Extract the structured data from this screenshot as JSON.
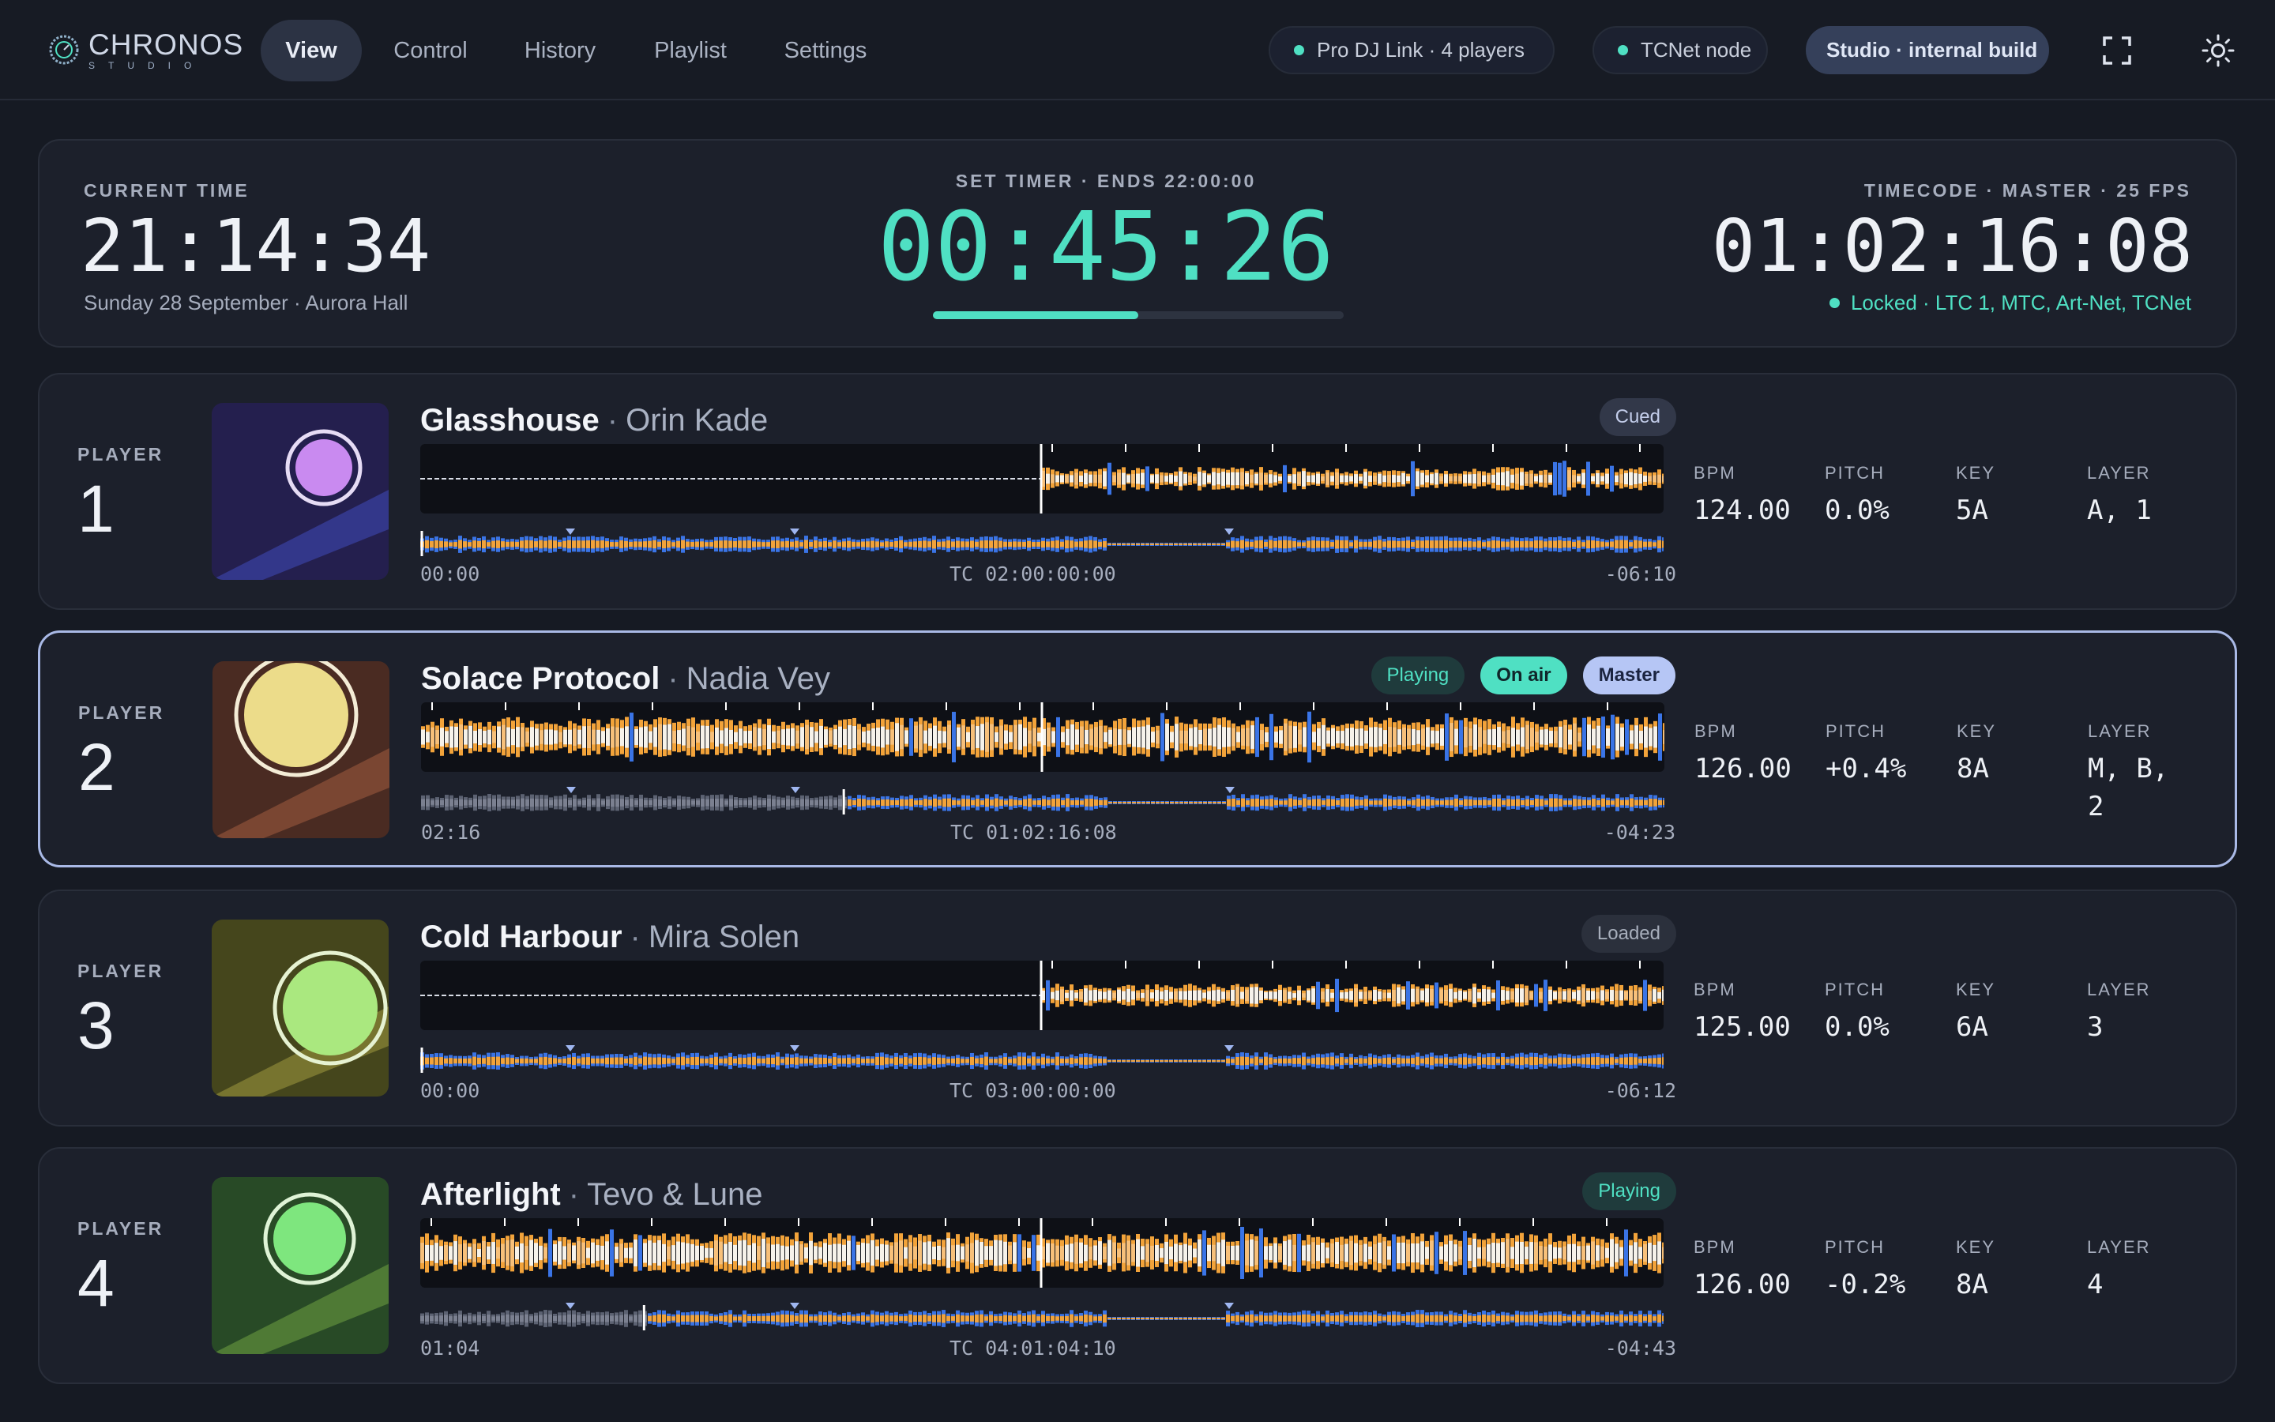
{
  "app": {
    "name": "CHRONOS",
    "sub": "STUDIO"
  },
  "nav": {
    "tabs": [
      {
        "label": "View",
        "active": true
      },
      {
        "label": "Control"
      },
      {
        "label": "History"
      },
      {
        "label": "Playlist"
      },
      {
        "label": "Settings"
      }
    ],
    "status_link": "Pro DJ Link · 4 players",
    "status_tcnet": "TCNet node",
    "build": "Studio · internal build",
    "icons": [
      "fullscreen-icon",
      "brightness-icon"
    ]
  },
  "clock": {
    "current_label": "CURRENT TIME",
    "current_time": "21:14:34",
    "current_sub": "Sunday 28 September · Aurora Hall",
    "timer_label": "SET TIMER · ENDS 22:00:00",
    "timer_value": "00:45:26",
    "timer_progress": 0.5,
    "tc_label": "TIMECODE · MASTER · 25 FPS",
    "tc_value": "01:02:16:08",
    "tc_status": "Locked · LTC 1, MTC, Art-Net, TCNet"
  },
  "colors": {
    "accent": "#4fe0c3",
    "orange": "#f2a33a",
    "blue": "#3a74e6",
    "select": "#a9b9e6"
  },
  "players": [
    {
      "label": "PLAYER",
      "num": "1",
      "title": "Glasshouse",
      "artist": "Orin Kade",
      "badges": [
        {
          "text": "Cued",
          "cls": "b-cued"
        }
      ],
      "elapsed": "00:00",
      "tc": "TC 02:00:00:00",
      "remain": "-06:10",
      "bpm_label": "BPM",
      "bpm": "124.00",
      "pitch_label": "PITCH",
      "pitch": "0.0%",
      "key_label": "KEY",
      "key": "5A",
      "layer_label": "LAYER",
      "layer": "A, 1",
      "progress": 0,
      "playing": false,
      "art": {
        "bg": "#241f4e",
        "stripe": "#33378a",
        "disc": "#c98af0",
        "ring": "#e6dcf5"
      }
    },
    {
      "label": "PLAYER",
      "num": "2",
      "title": "Solace Protocol",
      "artist": "Nadia Vey",
      "badges": [
        {
          "text": "Playing",
          "cls": "b-play"
        },
        {
          "text": "On air",
          "cls": "b-onair"
        },
        {
          "text": "Master",
          "cls": "b-master"
        }
      ],
      "elapsed": "02:16",
      "tc": "TC 01:02:16:08",
      "remain": "-04:23",
      "bpm_label": "BPM",
      "bpm": "126.00",
      "pitch_label": "PITCH",
      "pitch": "+0.4%",
      "key_label": "KEY",
      "key": "8A",
      "layer_label": "LAYER",
      "layer": "M, B,\n2",
      "progress": 0.34,
      "playing": true,
      "art": {
        "bg": "#4a2b22",
        "stripe": "#7a4632",
        "disc": "#ecdc8a",
        "ring": "#f4ecd6"
      }
    },
    {
      "label": "PLAYER",
      "num": "3",
      "title": "Cold Harbour",
      "artist": "Mira Solen",
      "badges": [
        {
          "text": "Loaded",
          "cls": "b-loaded"
        }
      ],
      "elapsed": "00:00",
      "tc": "TC 03:00:00:00",
      "remain": "-06:12",
      "bpm_label": "BPM",
      "bpm": "125.00",
      "pitch_label": "PITCH",
      "pitch": "0.0%",
      "key_label": "KEY",
      "key": "6A",
      "layer_label": "LAYER",
      "layer": "3",
      "progress": 0,
      "playing": false,
      "art": {
        "bg": "#45461c",
        "stripe": "#77742f",
        "disc": "#aae87f",
        "ring": "#e6f2d2"
      }
    },
    {
      "label": "PLAYER",
      "num": "4",
      "title": "Afterlight",
      "artist": "Tevo & Lune",
      "badges": [
        {
          "text": "Playing",
          "cls": "b-play"
        }
      ],
      "elapsed": "01:04",
      "tc": "TC 04:01:04:10",
      "remain": "-04:43",
      "bpm_label": "BPM",
      "bpm": "126.00",
      "pitch_label": "PITCH",
      "pitch": "-0.2%",
      "key_label": "KEY",
      "key": "8A",
      "layer_label": "LAYER",
      "layer": "4",
      "progress": 0.18,
      "playing": true,
      "art": {
        "bg": "#284a26",
        "stripe": "#4f7a35",
        "disc": "#7ee67e",
        "ring": "#dff3d6"
      }
    }
  ]
}
